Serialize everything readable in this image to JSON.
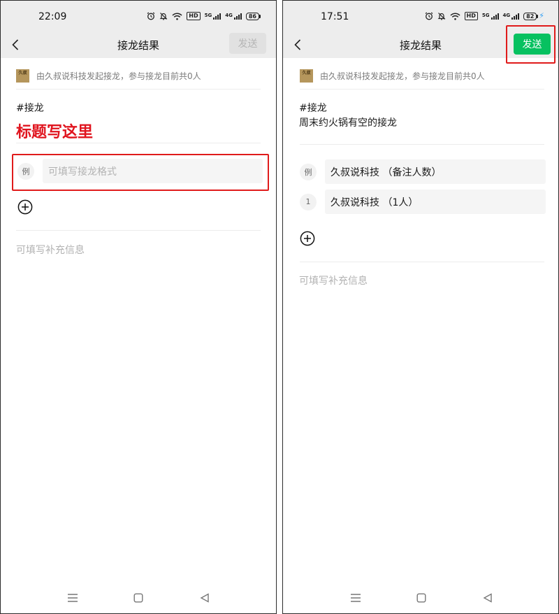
{
  "left": {
    "status_time": "22:09",
    "battery": "86",
    "nav_title": "接龙结果",
    "send_label": "发送",
    "avatar_text": "久叔",
    "initiator": "由久叔说科技发起接龙，参与接龙目前共0人",
    "hash_tag": "#接龙",
    "title_annotation": "标题写这里",
    "example_label": "例",
    "format_placeholder": "可填写接龙格式",
    "extra_placeholder": "可填写补充信息"
  },
  "right": {
    "status_time": "17:51",
    "battery": "82",
    "nav_title": "接龙结果",
    "send_label": "发送",
    "avatar_text": "久叔",
    "initiator": "由久叔说科技发起接龙，参与接龙目前共0人",
    "hash_tag": "#接龙",
    "title": "周末约火锅有空的接龙",
    "entries": [
      {
        "label": "例",
        "text": "久叔说科技 （备注人数）"
      },
      {
        "label": "1",
        "text": "久叔说科技 （1人）"
      }
    ],
    "extra_placeholder": "可填写补充信息"
  },
  "status": {
    "hd_label": "HD",
    "signal_label": "5G",
    "signal2_label": "4G"
  },
  "colors": {
    "accent_green": "#07c160",
    "annotation_red": "#e0141e",
    "nav_bg": "#ededed"
  },
  "icons": [
    "back-chevron-icon",
    "alarm-icon",
    "mute-bell-icon",
    "wifi-icon",
    "add-circle-icon",
    "menu-icon",
    "home-square-icon",
    "back-triangle-icon"
  ]
}
